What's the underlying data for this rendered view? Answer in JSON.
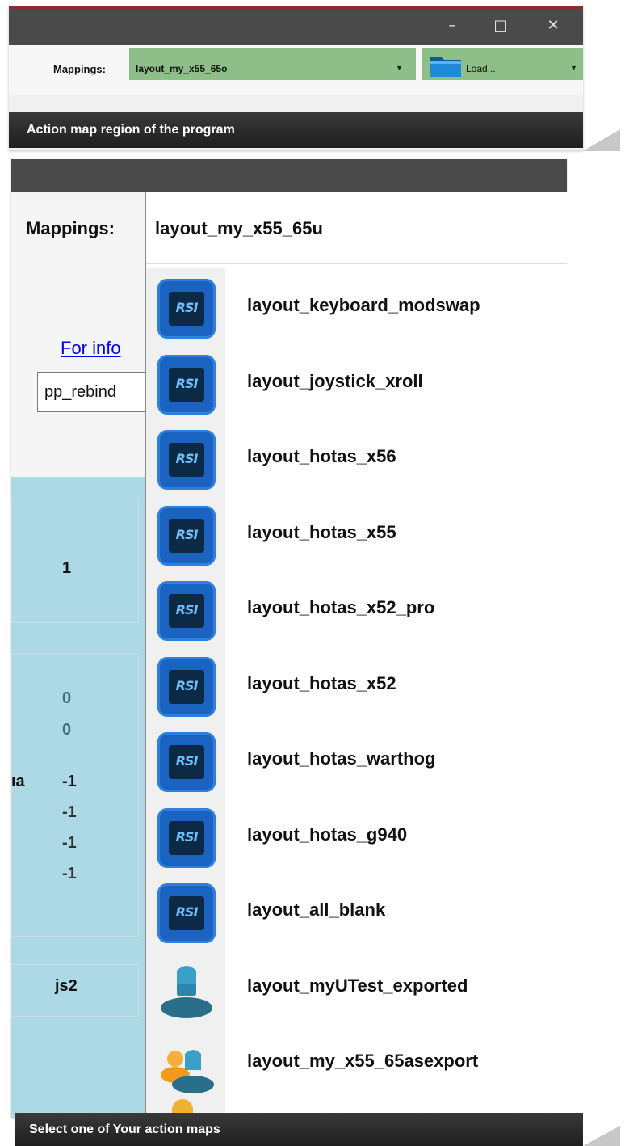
{
  "panel1": {
    "mappings_label": "Mappings:",
    "combo_value": "layout_my_x55_65o",
    "load_label": "Load...",
    "caption": "Action map region of the program",
    "window_buttons": [
      "–",
      "□",
      "✕"
    ]
  },
  "panel2": {
    "mappings_label": "Mappings:",
    "selected_value": "layout_my_x55_65u",
    "link_text": "For info",
    "textbox_value": "pp_rebind",
    "cells": {
      "device_num": "1",
      "values_gray": [
        "0",
        "0"
      ],
      "row_label": "ıa",
      "value_bold": "-1",
      "values_rest": [
        "-1",
        "-1",
        "-1"
      ],
      "device_id": "js2"
    },
    "items": [
      {
        "label": "layout_keyboard_modswap",
        "icon": "rsi-icon"
      },
      {
        "label": "layout_joystick_xroll",
        "icon": "rsi-icon"
      },
      {
        "label": "layout_hotas_x56",
        "icon": "rsi-icon"
      },
      {
        "label": "layout_hotas_x55",
        "icon": "rsi-icon"
      },
      {
        "label": "layout_hotas_x52_pro",
        "icon": "rsi-icon"
      },
      {
        "label": "layout_hotas_x52",
        "icon": "rsi-icon"
      },
      {
        "label": "layout_hotas_warthog",
        "icon": "rsi-icon"
      },
      {
        "label": "layout_hotas_g940",
        "icon": "rsi-icon"
      },
      {
        "label": "layout_all_blank",
        "icon": "rsi-icon"
      },
      {
        "label": "layout_myUTest_exported",
        "icon": "user-icon"
      },
      {
        "label": "layout_my_x55_65asexport",
        "icon": "users-icon"
      }
    ],
    "caption": "Select one of Your action maps",
    "icon_text": "RSI"
  },
  "colors": {
    "combo_green": "#8fbf88",
    "light_blue": "#add8e6",
    "rsi_blue": "#1a63c0",
    "titlebar": "#4a4a4a"
  }
}
